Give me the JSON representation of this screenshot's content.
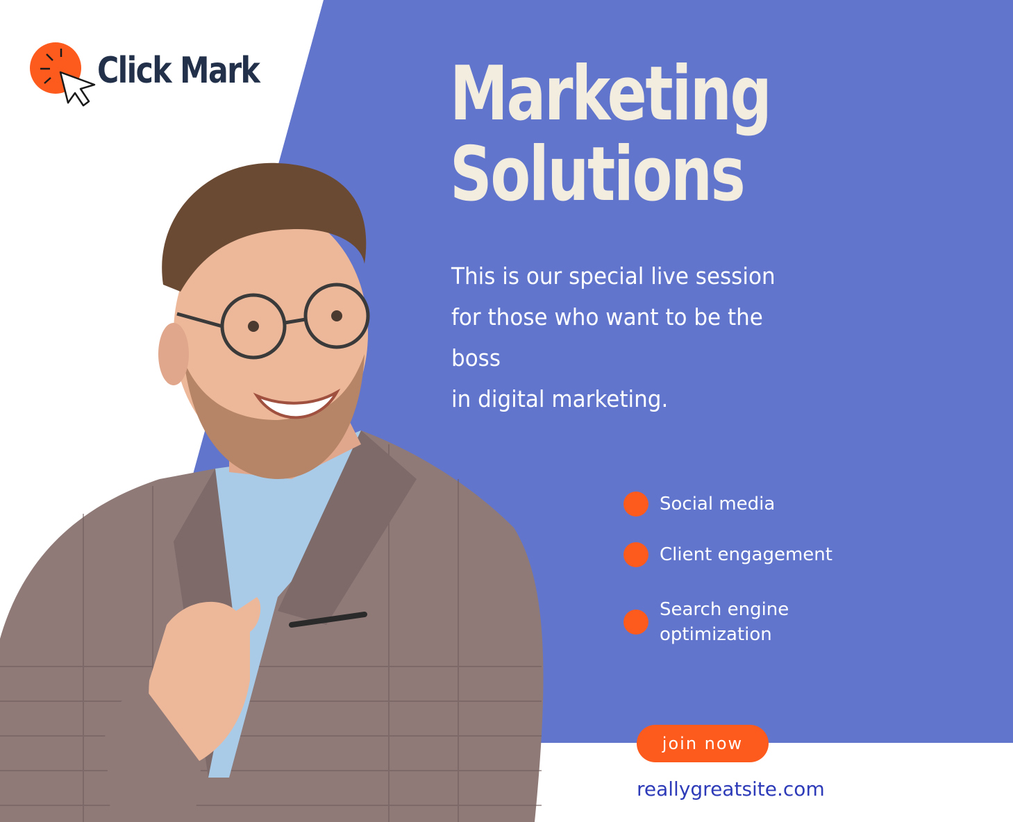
{
  "brand": {
    "name": "Click Mark",
    "logo_icon": "cursor-click-icon",
    "accent_color": "#fd5a1e",
    "text_color": "#22304a"
  },
  "hero": {
    "headline_line1": "Marketing",
    "headline_line2": "Solutions",
    "intro_lines": [
      "This is our special live session",
      "for those who want to be the",
      "boss",
      "in digital marketing."
    ],
    "panel_color": "#6175cc"
  },
  "features": [
    {
      "label": "Social media"
    },
    {
      "label": "Client engagement"
    },
    {
      "label": "Search engine\noptimization"
    }
  ],
  "cta": {
    "label": "join now"
  },
  "footer": {
    "website": "reallygreatsite.com"
  },
  "photo": {
    "subject": "person-pointing-photo"
  }
}
